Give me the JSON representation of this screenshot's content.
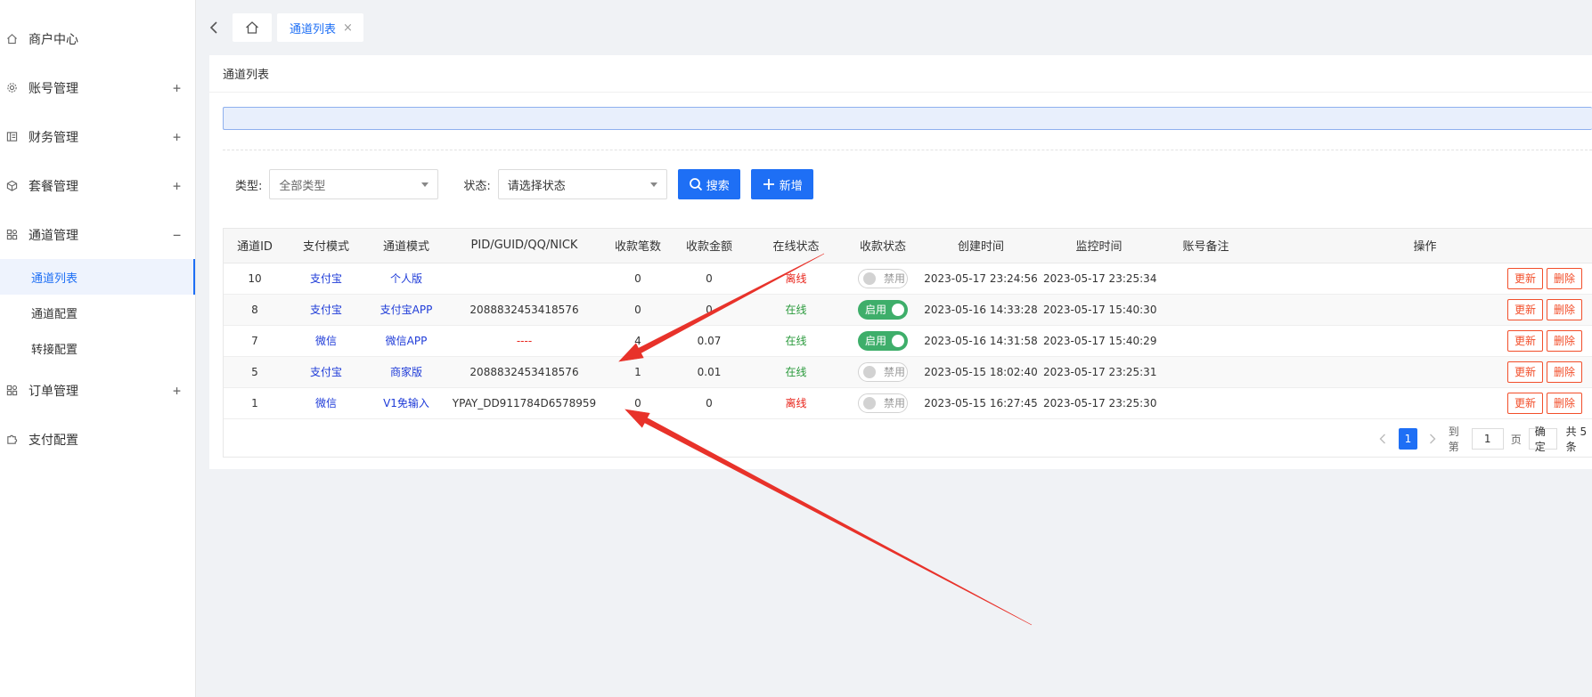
{
  "sidebar": {
    "items": [
      {
        "label": "商户中心",
        "icon": "home-icon",
        "expandable": false
      },
      {
        "label": "账号管理",
        "icon": "gear-icon",
        "expandable": true,
        "toggle": "+"
      },
      {
        "label": "财务管理",
        "icon": "ledger-icon",
        "expandable": true,
        "toggle": "+"
      },
      {
        "label": "套餐管理",
        "icon": "cube-icon",
        "expandable": true,
        "toggle": "+"
      },
      {
        "label": "通道管理",
        "icon": "grid-icon",
        "expandable": true,
        "toggle": "−"
      },
      {
        "label": "订单管理",
        "icon": "grid-icon",
        "expandable": true,
        "toggle": "+"
      },
      {
        "label": "支付配置",
        "icon": "puzzle-icon",
        "expandable": false
      }
    ],
    "sub_items": [
      "通道列表",
      "通道配置",
      "转接配置"
    ],
    "active_sub": "通道列表"
  },
  "tabs": {
    "home_icon": "home-icon",
    "current": "通道列表",
    "close": "×"
  },
  "card": {
    "title": "通道列表"
  },
  "filters": {
    "type_label": "类型:",
    "type_value": "全部类型",
    "status_label": "状态:",
    "status_value": "请选择状态",
    "search_label": "搜索",
    "add_label": "新增"
  },
  "table": {
    "headers": [
      "通道ID",
      "支付模式",
      "通道模式",
      "PID/GUID/QQ/NICK",
      "收款笔数",
      "收款金额",
      "在线状态",
      "收款状态",
      "创建时间",
      "监控时间",
      "账号备注",
      "操作"
    ],
    "rows": [
      {
        "id": "10",
        "pay_mode": "支付宝",
        "channel_mode": "个人版",
        "pid": "",
        "count": "0",
        "amount": "0",
        "online": "离线",
        "online_color": "#e8241b",
        "collect": "禁用",
        "collect_on": false,
        "created": "2023-05-17 23:24:56",
        "monitor": "2023-05-17 23:25:34",
        "remark": ""
      },
      {
        "id": "8",
        "pay_mode": "支付宝",
        "channel_mode": "支付宝APP",
        "pid": "2088832453418576",
        "count": "0",
        "amount": "0",
        "online": "在线",
        "online_color": "#2a9a3c",
        "collect": "启用",
        "collect_on": true,
        "created": "2023-05-16 14:33:28",
        "monitor": "2023-05-17 15:40:30",
        "remark": ""
      },
      {
        "id": "7",
        "pay_mode": "微信",
        "channel_mode": "微信APP",
        "pid": "----",
        "count": "4",
        "amount": "0.07",
        "online": "在线",
        "online_color": "#2a9a3c",
        "collect": "启用",
        "collect_on": true,
        "created": "2023-05-16 14:31:58",
        "monitor": "2023-05-17 15:40:29",
        "remark": ""
      },
      {
        "id": "5",
        "pay_mode": "支付宝",
        "channel_mode": "商家版",
        "pid": "2088832453418576",
        "count": "1",
        "amount": "0.01",
        "online": "在线",
        "online_color": "#2a9a3c",
        "collect": "禁用",
        "collect_on": false,
        "created": "2023-05-15 18:02:40",
        "monitor": "2023-05-17 23:25:31",
        "remark": ""
      },
      {
        "id": "1",
        "pay_mode": "微信",
        "channel_mode": "V1免输入",
        "pid": "YPAY_DD911784D6578959",
        "count": "0",
        "amount": "0",
        "online": "离线",
        "online_color": "#e8241b",
        "collect": "禁用",
        "collect_on": false,
        "created": "2023-05-15 16:27:45",
        "monitor": "2023-05-17 23:25:30",
        "remark": ""
      }
    ],
    "update_label": "更新",
    "delete_label": "删除"
  },
  "pagination": {
    "current_page": "1",
    "goto_label": "到第",
    "goto_value": "1",
    "page_unit": "页",
    "confirm_label": "确定",
    "total_label": "共 5 条"
  },
  "colors": {
    "accent": "#1e6ff5",
    "danger": "#f24e2a",
    "online": "#2a9a3c",
    "offline": "#e8241b",
    "annotation_arrow": "#e8322a"
  }
}
